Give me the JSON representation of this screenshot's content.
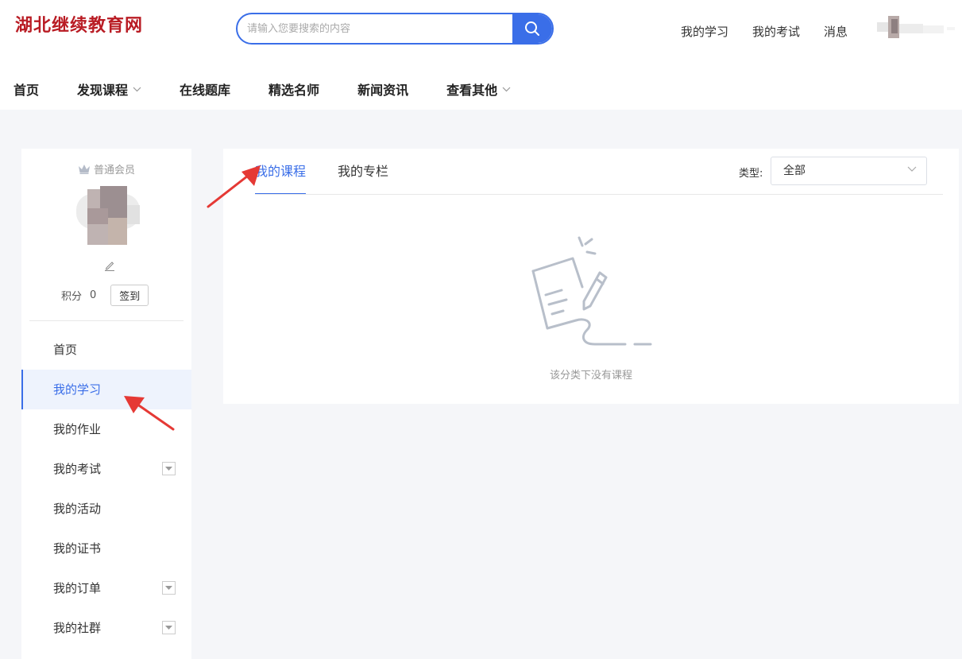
{
  "header": {
    "logo": "湖北继续教育网",
    "search_placeholder": "请输入您要搜索的内容",
    "links": [
      "我的学习",
      "我的考试",
      "消息"
    ],
    "accent": "#3a6ee8",
    "logo_color": "#b91c24"
  },
  "nav": {
    "items": [
      {
        "label": "首页"
      },
      {
        "label": "发现课程",
        "has_dropdown": true
      },
      {
        "label": "在线题库"
      },
      {
        "label": "精选名师"
      },
      {
        "label": "新闻资讯"
      },
      {
        "label": "查看其他",
        "has_dropdown": true
      }
    ]
  },
  "sidebar": {
    "member_level": "普通会员",
    "points_label": "积分",
    "points_value": "0",
    "sign_in_label": "签到",
    "items": [
      {
        "label": "首页"
      },
      {
        "label": "我的学习",
        "active": true
      },
      {
        "label": "我的作业"
      },
      {
        "label": "我的考试",
        "has_dropdown": true
      },
      {
        "label": "我的活动"
      },
      {
        "label": "我的证书"
      },
      {
        "label": "我的订单",
        "has_dropdown": true
      },
      {
        "label": "我的社群",
        "has_dropdown": true
      }
    ]
  },
  "main": {
    "tabs": [
      {
        "label": "我的课程",
        "active": true
      },
      {
        "label": "我的专栏"
      }
    ],
    "type_label": "类型:",
    "type_value": "全部",
    "empty_text": "该分类下没有课程"
  }
}
